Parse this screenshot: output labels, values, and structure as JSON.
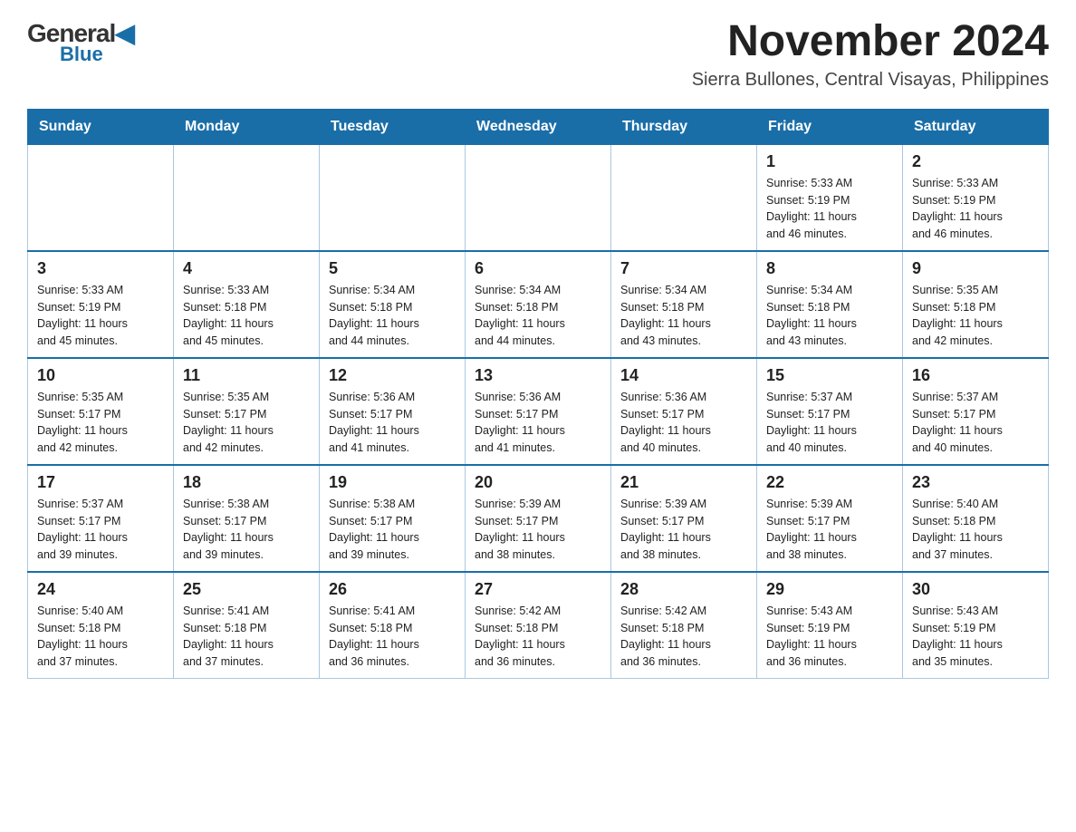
{
  "logo": {
    "general": "General",
    "blue": "Blue",
    "triangle": "▶"
  },
  "title": "November 2024",
  "location": "Sierra Bullones, Central Visayas, Philippines",
  "weekdays": [
    "Sunday",
    "Monday",
    "Tuesday",
    "Wednesday",
    "Thursday",
    "Friday",
    "Saturday"
  ],
  "weeks": [
    [
      {
        "day": "",
        "info": ""
      },
      {
        "day": "",
        "info": ""
      },
      {
        "day": "",
        "info": ""
      },
      {
        "day": "",
        "info": ""
      },
      {
        "day": "",
        "info": ""
      },
      {
        "day": "1",
        "info": "Sunrise: 5:33 AM\nSunset: 5:19 PM\nDaylight: 11 hours\nand 46 minutes."
      },
      {
        "day": "2",
        "info": "Sunrise: 5:33 AM\nSunset: 5:19 PM\nDaylight: 11 hours\nand 46 minutes."
      }
    ],
    [
      {
        "day": "3",
        "info": "Sunrise: 5:33 AM\nSunset: 5:19 PM\nDaylight: 11 hours\nand 45 minutes."
      },
      {
        "day": "4",
        "info": "Sunrise: 5:33 AM\nSunset: 5:18 PM\nDaylight: 11 hours\nand 45 minutes."
      },
      {
        "day": "5",
        "info": "Sunrise: 5:34 AM\nSunset: 5:18 PM\nDaylight: 11 hours\nand 44 minutes."
      },
      {
        "day": "6",
        "info": "Sunrise: 5:34 AM\nSunset: 5:18 PM\nDaylight: 11 hours\nand 44 minutes."
      },
      {
        "day": "7",
        "info": "Sunrise: 5:34 AM\nSunset: 5:18 PM\nDaylight: 11 hours\nand 43 minutes."
      },
      {
        "day": "8",
        "info": "Sunrise: 5:34 AM\nSunset: 5:18 PM\nDaylight: 11 hours\nand 43 minutes."
      },
      {
        "day": "9",
        "info": "Sunrise: 5:35 AM\nSunset: 5:18 PM\nDaylight: 11 hours\nand 42 minutes."
      }
    ],
    [
      {
        "day": "10",
        "info": "Sunrise: 5:35 AM\nSunset: 5:17 PM\nDaylight: 11 hours\nand 42 minutes."
      },
      {
        "day": "11",
        "info": "Sunrise: 5:35 AM\nSunset: 5:17 PM\nDaylight: 11 hours\nand 42 minutes."
      },
      {
        "day": "12",
        "info": "Sunrise: 5:36 AM\nSunset: 5:17 PM\nDaylight: 11 hours\nand 41 minutes."
      },
      {
        "day": "13",
        "info": "Sunrise: 5:36 AM\nSunset: 5:17 PM\nDaylight: 11 hours\nand 41 minutes."
      },
      {
        "day": "14",
        "info": "Sunrise: 5:36 AM\nSunset: 5:17 PM\nDaylight: 11 hours\nand 40 minutes."
      },
      {
        "day": "15",
        "info": "Sunrise: 5:37 AM\nSunset: 5:17 PM\nDaylight: 11 hours\nand 40 minutes."
      },
      {
        "day": "16",
        "info": "Sunrise: 5:37 AM\nSunset: 5:17 PM\nDaylight: 11 hours\nand 40 minutes."
      }
    ],
    [
      {
        "day": "17",
        "info": "Sunrise: 5:37 AM\nSunset: 5:17 PM\nDaylight: 11 hours\nand 39 minutes."
      },
      {
        "day": "18",
        "info": "Sunrise: 5:38 AM\nSunset: 5:17 PM\nDaylight: 11 hours\nand 39 minutes."
      },
      {
        "day": "19",
        "info": "Sunrise: 5:38 AM\nSunset: 5:17 PM\nDaylight: 11 hours\nand 39 minutes."
      },
      {
        "day": "20",
        "info": "Sunrise: 5:39 AM\nSunset: 5:17 PM\nDaylight: 11 hours\nand 38 minutes."
      },
      {
        "day": "21",
        "info": "Sunrise: 5:39 AM\nSunset: 5:17 PM\nDaylight: 11 hours\nand 38 minutes."
      },
      {
        "day": "22",
        "info": "Sunrise: 5:39 AM\nSunset: 5:17 PM\nDaylight: 11 hours\nand 38 minutes."
      },
      {
        "day": "23",
        "info": "Sunrise: 5:40 AM\nSunset: 5:18 PM\nDaylight: 11 hours\nand 37 minutes."
      }
    ],
    [
      {
        "day": "24",
        "info": "Sunrise: 5:40 AM\nSunset: 5:18 PM\nDaylight: 11 hours\nand 37 minutes."
      },
      {
        "day": "25",
        "info": "Sunrise: 5:41 AM\nSunset: 5:18 PM\nDaylight: 11 hours\nand 37 minutes."
      },
      {
        "day": "26",
        "info": "Sunrise: 5:41 AM\nSunset: 5:18 PM\nDaylight: 11 hours\nand 36 minutes."
      },
      {
        "day": "27",
        "info": "Sunrise: 5:42 AM\nSunset: 5:18 PM\nDaylight: 11 hours\nand 36 minutes."
      },
      {
        "day": "28",
        "info": "Sunrise: 5:42 AM\nSunset: 5:18 PM\nDaylight: 11 hours\nand 36 minutes."
      },
      {
        "day": "29",
        "info": "Sunrise: 5:43 AM\nSunset: 5:19 PM\nDaylight: 11 hours\nand 36 minutes."
      },
      {
        "day": "30",
        "info": "Sunrise: 5:43 AM\nSunset: 5:19 PM\nDaylight: 11 hours\nand 35 minutes."
      }
    ]
  ]
}
